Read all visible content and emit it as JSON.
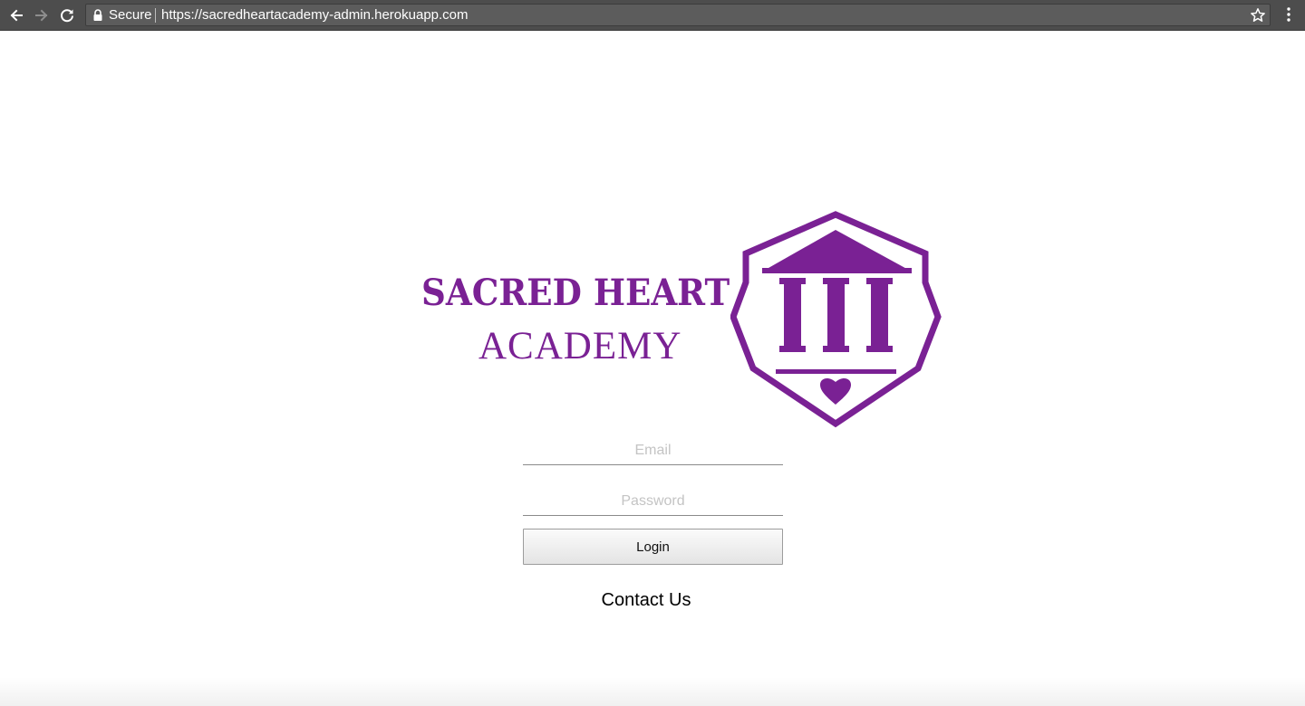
{
  "browser": {
    "secure_label": "Secure",
    "url": "https://sacredheartacademy-admin.herokuapp.com",
    "icons": [
      "back-arrow-icon",
      "forward-arrow-icon",
      "reload-icon",
      "lock-icon",
      "star-icon",
      "kebab-menu-icon"
    ]
  },
  "logo": {
    "line1": "SACRED HEART",
    "line2": "ACADEMY",
    "color": "#7a2194",
    "crest_icon": "shield-temple-heart-icon"
  },
  "form": {
    "email_placeholder": "Email",
    "password_placeholder": "Password",
    "login_label": "Login"
  },
  "footer": {
    "contact_label": "Contact Us"
  }
}
